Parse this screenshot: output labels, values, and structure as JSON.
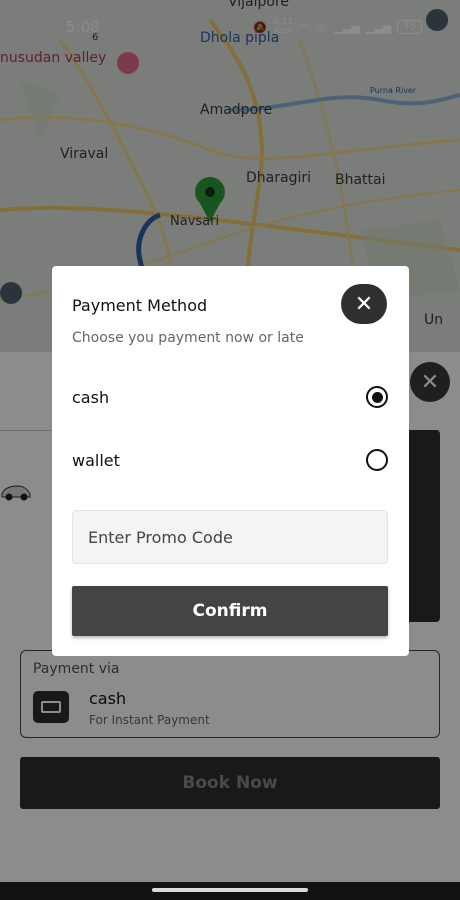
{
  "status_bar": {
    "time": "5:08",
    "network_speed": "0.11",
    "network_unit": "KB/S",
    "battery": "75"
  },
  "map": {
    "labels": [
      "Vijalpore",
      "Dhola pipla",
      "nusudan valley",
      "Amadpore",
      "Purna River",
      "Viraval",
      "Dharagiri",
      "Bhattai",
      "Navsari",
      "Un"
    ],
    "road_number": "6"
  },
  "dialog": {
    "title": "Payment Method",
    "subtitle": "Choose you payment now or late",
    "options": [
      {
        "label": "cash",
        "selected": true
      },
      {
        "label": "wallet",
        "selected": false
      }
    ],
    "promo_placeholder": "Enter Promo Code",
    "confirm_label": "Confirm",
    "close_glyph": "✕"
  },
  "sheet": {
    "payment_via_label": "Payment via",
    "payment_method": "cash",
    "payment_sub": "For Instant Payment",
    "book_label": "Book Now",
    "close_glyph": "✕"
  },
  "colors": {
    "accent_dark": "#2e2e2e",
    "pin_green": "#2e9d3a",
    "route_blue": "#2f5ea8"
  }
}
